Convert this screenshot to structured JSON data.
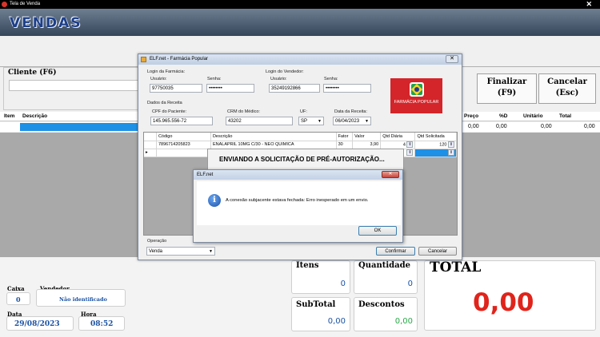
{
  "window": {
    "title": "Tela de Venda",
    "brand": "VENDAS"
  },
  "cliente": {
    "label": "Cliente (F6)"
  },
  "buttons": {
    "finalizar": "Finalizar",
    "finalizar_key": "(F9)",
    "cancelar": "Cancelar",
    "cancelar_key": "(Esc)"
  },
  "items_table": {
    "left_headers": [
      "Item",
      "Descrição"
    ],
    "right_headers": [
      "Preço",
      "%D",
      "Unitário",
      "Total"
    ],
    "right_values": [
      "0,00",
      "0,00",
      "0,00",
      "0,00"
    ]
  },
  "footer": {
    "caixa_label": "Caixa",
    "caixa_value": "0",
    "vendedor_label": "Vendedor",
    "vendedor_value": "Não identificado",
    "data_label": "Data",
    "data_value": "29/08/2023",
    "hora_label": "Hora",
    "hora_value": "08:52"
  },
  "totals": {
    "itens_label": "Itens",
    "itens_value": "0",
    "quantidade_label": "Quantidade",
    "quantidade_value": "0",
    "subtotal_label": "SubTotal",
    "subtotal_value": "0,00",
    "descontos_label": "Descontos",
    "descontos_value": "0,00",
    "total_label": "TOTAL",
    "total_value": "0,00"
  },
  "dialog": {
    "title": "ELF.net - Farmácia Popular",
    "login_farmacia": "Login da Farmácia:",
    "usuario_label": "Usuário:",
    "usuario_farm": "97750035",
    "senha_label": "Senha:",
    "senha_farm": "••••••••",
    "login_vendedor": "Login do Vendedor:",
    "usuario_vend": "35249192866",
    "senha_vend": "••••••••",
    "logo_text": "FARMÁCIA POPULAR",
    "dados_receita": "Dados da Receita",
    "cpf_label": "CPF do Paciente:",
    "cpf_value": "145.965.556-72",
    "crm_label": "CRM do Médico:",
    "crm_value": "43202",
    "uf_label": "UF:",
    "uf_value": "SP",
    "data_receita_label": "Data da Receita:",
    "data_receita_value": "06/04/2023",
    "grid_headers": [
      "Código",
      "Descrição",
      "Fator",
      "Valor",
      "Qtd Diária",
      "Qtd Solicitada"
    ],
    "grid_row": [
      "7896714205823",
      "ENALAPRIL 10MG C/30 - NEO QUIMICA",
      "30",
      "3,90",
      "4",
      "120"
    ],
    "sending_msg": "ENVIANDO A SOLICITAÇÃO DE PRÉ-AUTORIZAÇÃO...",
    "operacao_label": "Operação",
    "operacao_value": "Venda",
    "confirmar": "Confirmar",
    "cancelar": "Cancelar"
  },
  "error_box": {
    "title": "ELF.net",
    "message": "A conexão subjacente estava fechada: Erro inesperado em um envio.",
    "ok": "OK"
  },
  "colors": {
    "accent_blue": "#1b52a3",
    "total_red": "#e0241b",
    "descontos_green": "#2aa84a",
    "logo_red": "#d3252a"
  }
}
